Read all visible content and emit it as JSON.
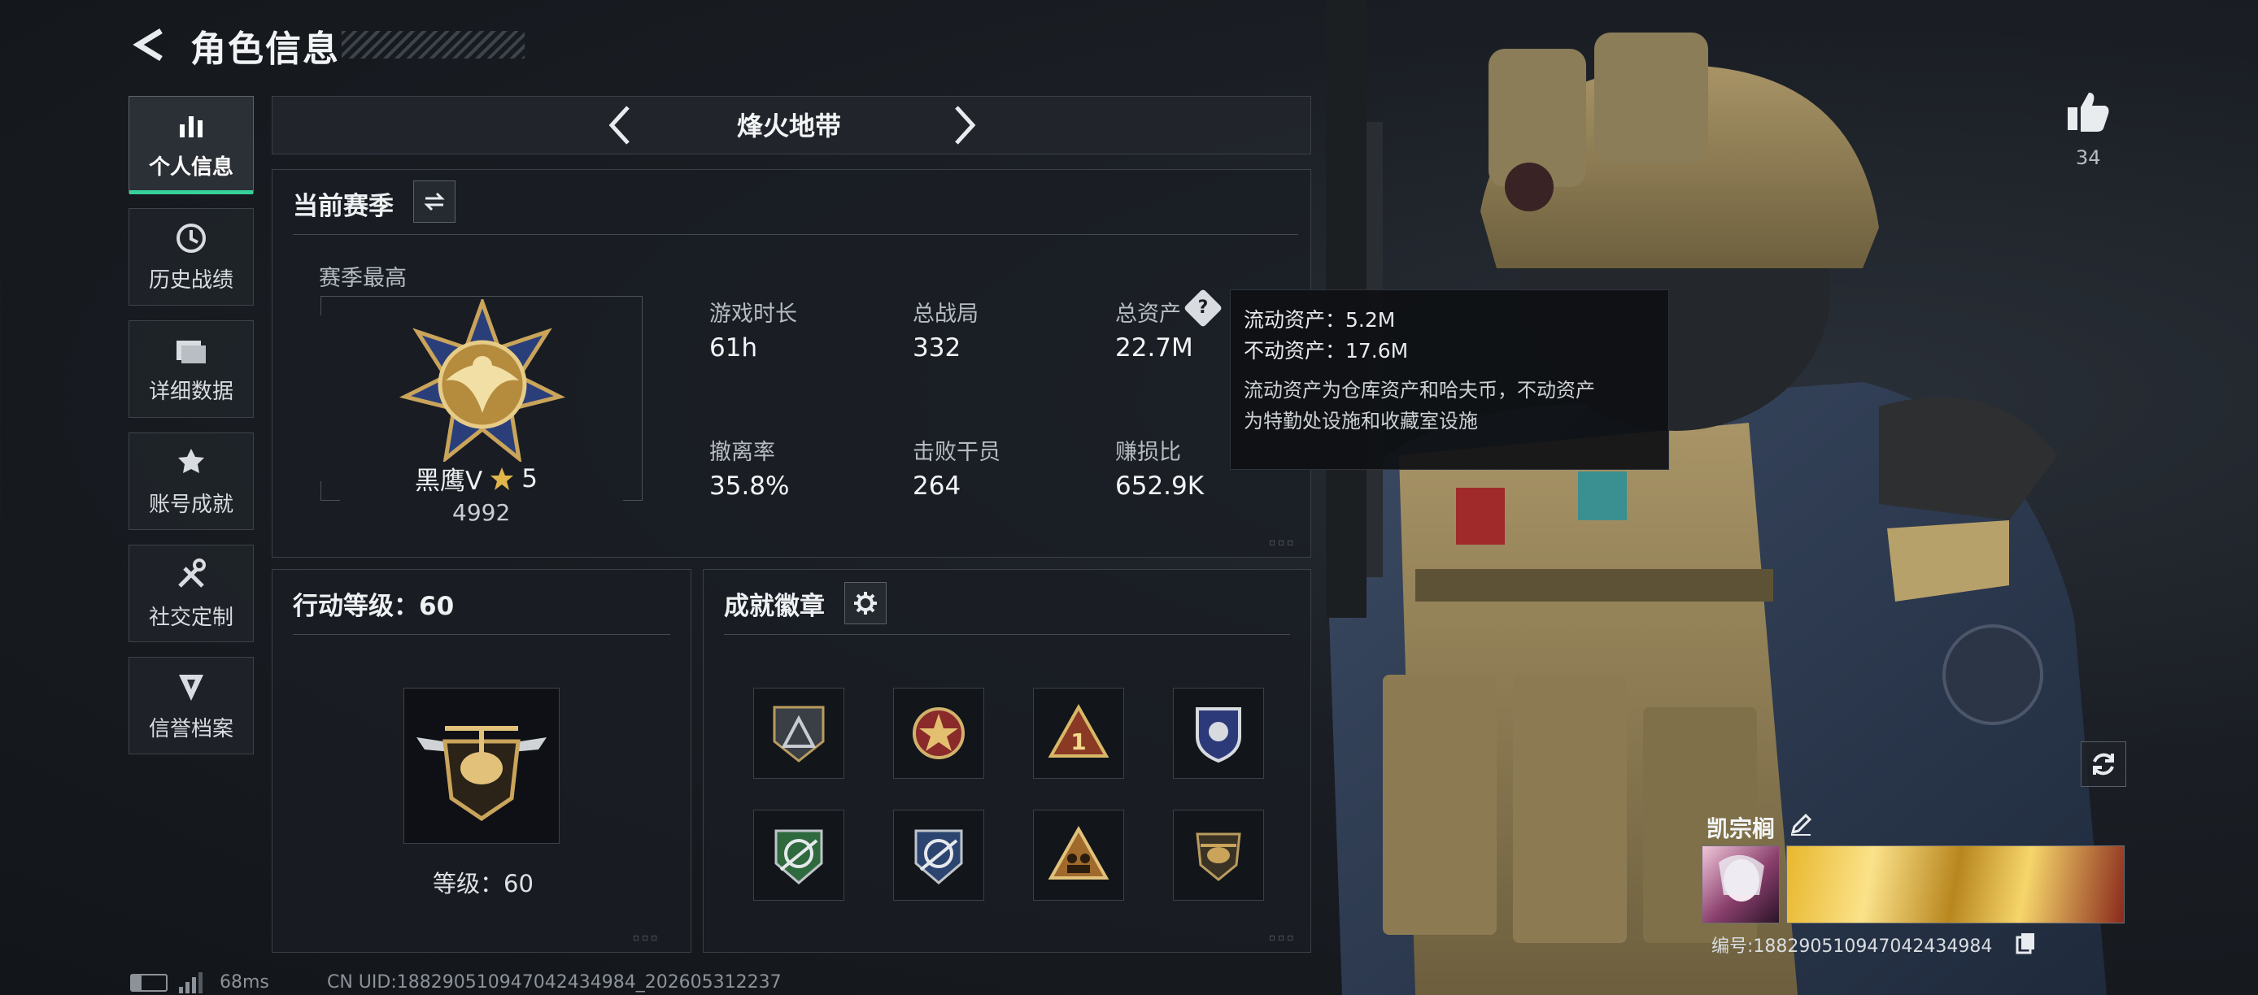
{
  "header": {
    "title": "角色信息"
  },
  "sidebar": {
    "items": [
      {
        "label": "个人信息",
        "icon": "bar-chart-icon",
        "active": true
      },
      {
        "label": "历史战绩",
        "icon": "history-icon"
      },
      {
        "label": "详细数据",
        "icon": "folder-icon"
      },
      {
        "label": "账号成就",
        "icon": "achievement-icon"
      },
      {
        "label": "社交定制",
        "icon": "tools-icon"
      },
      {
        "label": "信誉档案",
        "icon": "shield-icon"
      }
    ]
  },
  "mode_selector": {
    "label": "烽火地带"
  },
  "season": {
    "title": "当前赛季",
    "best_label": "赛季最高",
    "rank_name": "黑鹰V",
    "rank_stars": "5",
    "rank_score": "4992",
    "stats": [
      {
        "label": "游戏时长",
        "value": "61h"
      },
      {
        "label": "总战局",
        "value": "332"
      },
      {
        "label": "总资产",
        "value": "22.7M"
      },
      {
        "label": "撤离率",
        "value": "35.8%"
      },
      {
        "label": "击败干员",
        "value": "264"
      },
      {
        "label": "赚损比",
        "value": "652.9K"
      }
    ]
  },
  "tooltip": {
    "liquid": "流动资产：5.2M",
    "fixed": "不动资产：17.6M",
    "note_line1": "流动资产为仓库资产和哈夫币，不动资产",
    "note_line2": "为特勤处设施和收藏室设施"
  },
  "action_level": {
    "title": "行动等级：60",
    "level_label": "等级：60"
  },
  "achievements": {
    "title": "成就徽章",
    "badges": [
      "triangle-badge-icon",
      "star-cross-badge-icon",
      "number-one-badge-icon",
      "shield-eagle-badge-icon",
      "green-rotate-badge-icon",
      "blue-rotate-badge-icon",
      "people-triangle-badge-icon",
      "helicopter-badge-icon"
    ]
  },
  "profile": {
    "likes": "34",
    "player_name": "凯宗榈",
    "player_id": "编号:18829051094704243498​4"
  },
  "status_bar": {
    "ping": "68ms",
    "uid": "CN UID:1882905109470424349​84_202605312237"
  },
  "colors": {
    "accent": "#36d19a",
    "background": "#15191e",
    "panel": "#1d2128"
  }
}
